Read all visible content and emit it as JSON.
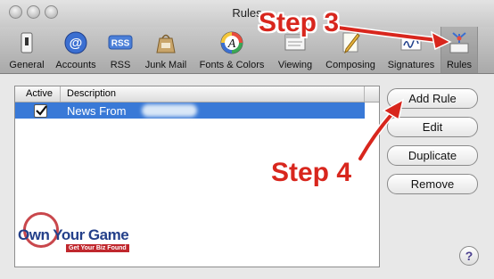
{
  "window": {
    "title": "Rules"
  },
  "toolbar": {
    "items": [
      {
        "label": "General",
        "icon": "switch-icon"
      },
      {
        "label": "Accounts",
        "icon": "at-sign-icon"
      },
      {
        "label": "RSS",
        "icon": "rss-icon"
      },
      {
        "label": "Junk Mail",
        "icon": "junk-mail-bag-icon"
      },
      {
        "label": "Fonts & Colors",
        "icon": "fonts-colors-icon"
      },
      {
        "label": "Viewing",
        "icon": "viewing-icon"
      },
      {
        "label": "Composing",
        "icon": "pencil-icon"
      },
      {
        "label": "Signatures",
        "icon": "signature-icon"
      },
      {
        "label": "Rules",
        "icon": "rules-icon"
      }
    ],
    "rss_badge": "RSS",
    "fonts_glyph": "A",
    "selected": "Rules"
  },
  "rules_list": {
    "columns": {
      "active": "Active",
      "description": "Description"
    },
    "rows": [
      {
        "active": true,
        "description": "News From"
      }
    ]
  },
  "buttons": {
    "add_rule": "Add Rule",
    "edit": "Edit",
    "duplicate": "Duplicate",
    "remove": "Remove"
  },
  "help": "?",
  "annotations": {
    "step3": "Step 3",
    "step4": "Step 4"
  },
  "watermark": {
    "main": "Own Your Game",
    "tagline": "Get Your Biz Found"
  },
  "colors": {
    "selection": "#3979d7",
    "annotation_red": "#d8261d",
    "logo_blue": "#24408a"
  }
}
